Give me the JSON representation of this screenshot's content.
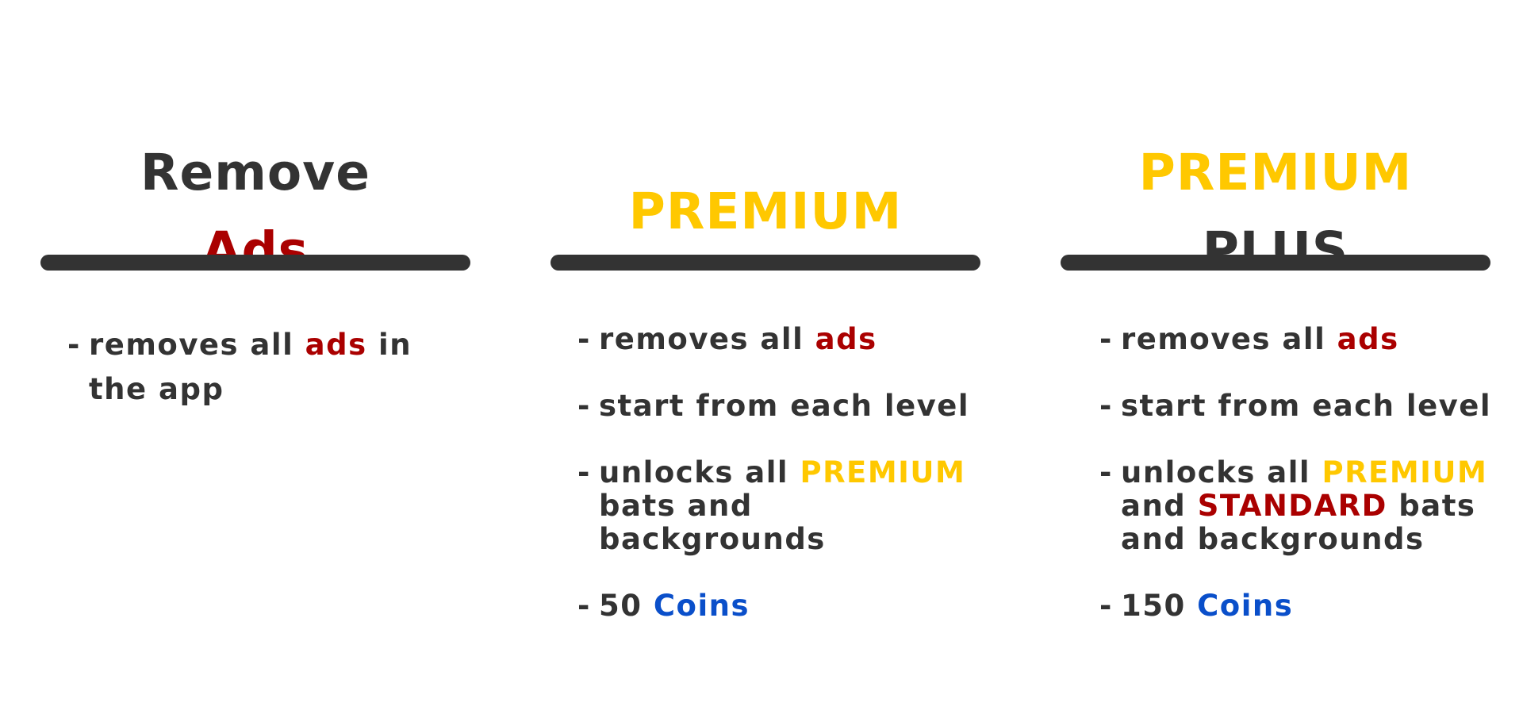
{
  "colors": {
    "text": "#333333",
    "accent_red": "#AA0000",
    "accent_yellow": "#FFC800",
    "accent_blue": "#0A4FCA",
    "divider": "#333333",
    "background": "#FFFFFF"
  },
  "bullet": "-",
  "plans": [
    {
      "title": [
        {
          "text": "Remove",
          "color": "#333333"
        },
        {
          "text": "Ads",
          "color": "#AA0000"
        }
      ],
      "features": [
        [
          {
            "text": "removes all "
          },
          {
            "text": "ads",
            "color": "#AA0000"
          },
          {
            "text": " in the app"
          }
        ]
      ]
    },
    {
      "title": [
        {
          "text": "PREMIUM",
          "color": "#FFC800"
        }
      ],
      "features": [
        [
          {
            "text": "removes all "
          },
          {
            "text": "ads",
            "color": "#AA0000"
          }
        ],
        [
          {
            "text": "start from each level"
          }
        ],
        [
          {
            "text": "unlocks all "
          },
          {
            "text": "PREMIUM",
            "color": "#FFC800"
          },
          {
            "text": " bats and backgrounds"
          }
        ],
        [
          {
            "text": "50 "
          },
          {
            "text": "Coins",
            "color": "#0A4FCA"
          }
        ]
      ]
    },
    {
      "title": [
        {
          "text": "PREMIUM",
          "color": "#FFC800"
        },
        {
          "text": "PLUS",
          "color": "#333333"
        }
      ],
      "features": [
        [
          {
            "text": "removes all "
          },
          {
            "text": "ads",
            "color": "#AA0000"
          }
        ],
        [
          {
            "text": "start from each level"
          }
        ],
        [
          {
            "text": "unlocks all "
          },
          {
            "text": "PREMIUM",
            "color": "#FFC800"
          },
          {
            "text": " and "
          },
          {
            "text": "STANDARD",
            "color": "#AA0000"
          },
          {
            "text": " bats and backgrounds"
          }
        ],
        [
          {
            "text": "150 "
          },
          {
            "text": "Coins",
            "color": "#0A4FCA"
          }
        ]
      ]
    }
  ]
}
